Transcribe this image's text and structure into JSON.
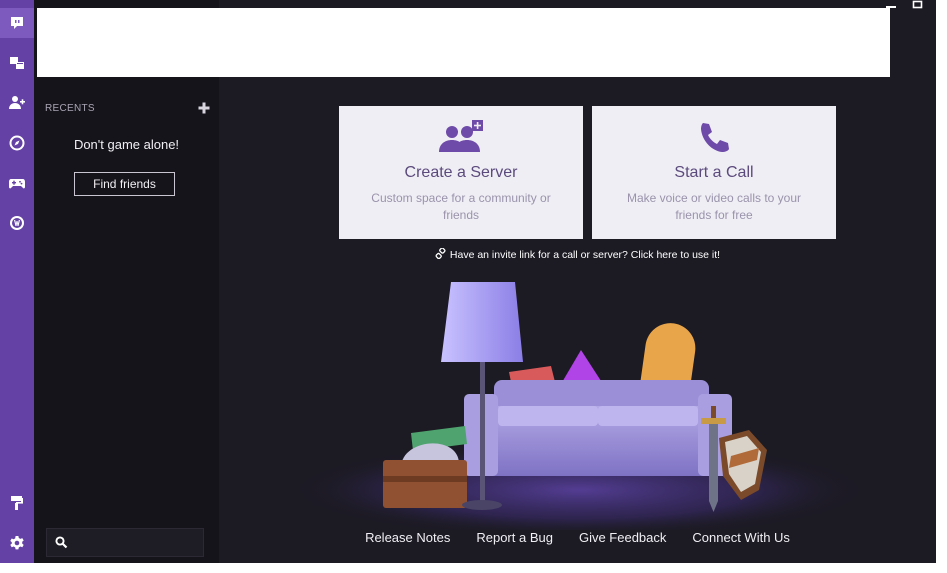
{
  "rail": {
    "items": [
      {
        "name": "chat",
        "icon": "chat-bubble-icon",
        "active": true
      },
      {
        "name": "servers",
        "icon": "servers-icon"
      },
      {
        "name": "friends",
        "icon": "add-friend-icon"
      },
      {
        "name": "discover",
        "icon": "compass-icon"
      },
      {
        "name": "games",
        "icon": "gamepad-icon"
      },
      {
        "name": "curse",
        "icon": "curse-logo-icon"
      }
    ],
    "bottom": [
      {
        "name": "theme",
        "icon": "paint-roller-icon"
      },
      {
        "name": "settings",
        "icon": "gear-icon"
      }
    ]
  },
  "sidebar": {
    "recents_title": "RECENTS",
    "empty_message": "Don't game alone!",
    "find_friends_label": "Find friends",
    "search_placeholder": ""
  },
  "main": {
    "cards": [
      {
        "title": "Create a Server",
        "description": "Custom space for a community or friends",
        "icon": "create-server-icon"
      },
      {
        "title": "Start a Call",
        "description": "Make voice or video calls to your friends for free",
        "icon": "phone-icon"
      }
    ],
    "invite_text": "Have an invite link for a call or server? Click here to use it!",
    "footer_links": [
      "Release Notes",
      "Report a Bug",
      "Give Feedback",
      "Connect With Us"
    ]
  },
  "colors": {
    "rail": "#6441a4",
    "sidebar": "#16141b",
    "main_bg": "#1c1a23",
    "card_bg": "#f0eef5",
    "accent": "#6e4ba8"
  }
}
